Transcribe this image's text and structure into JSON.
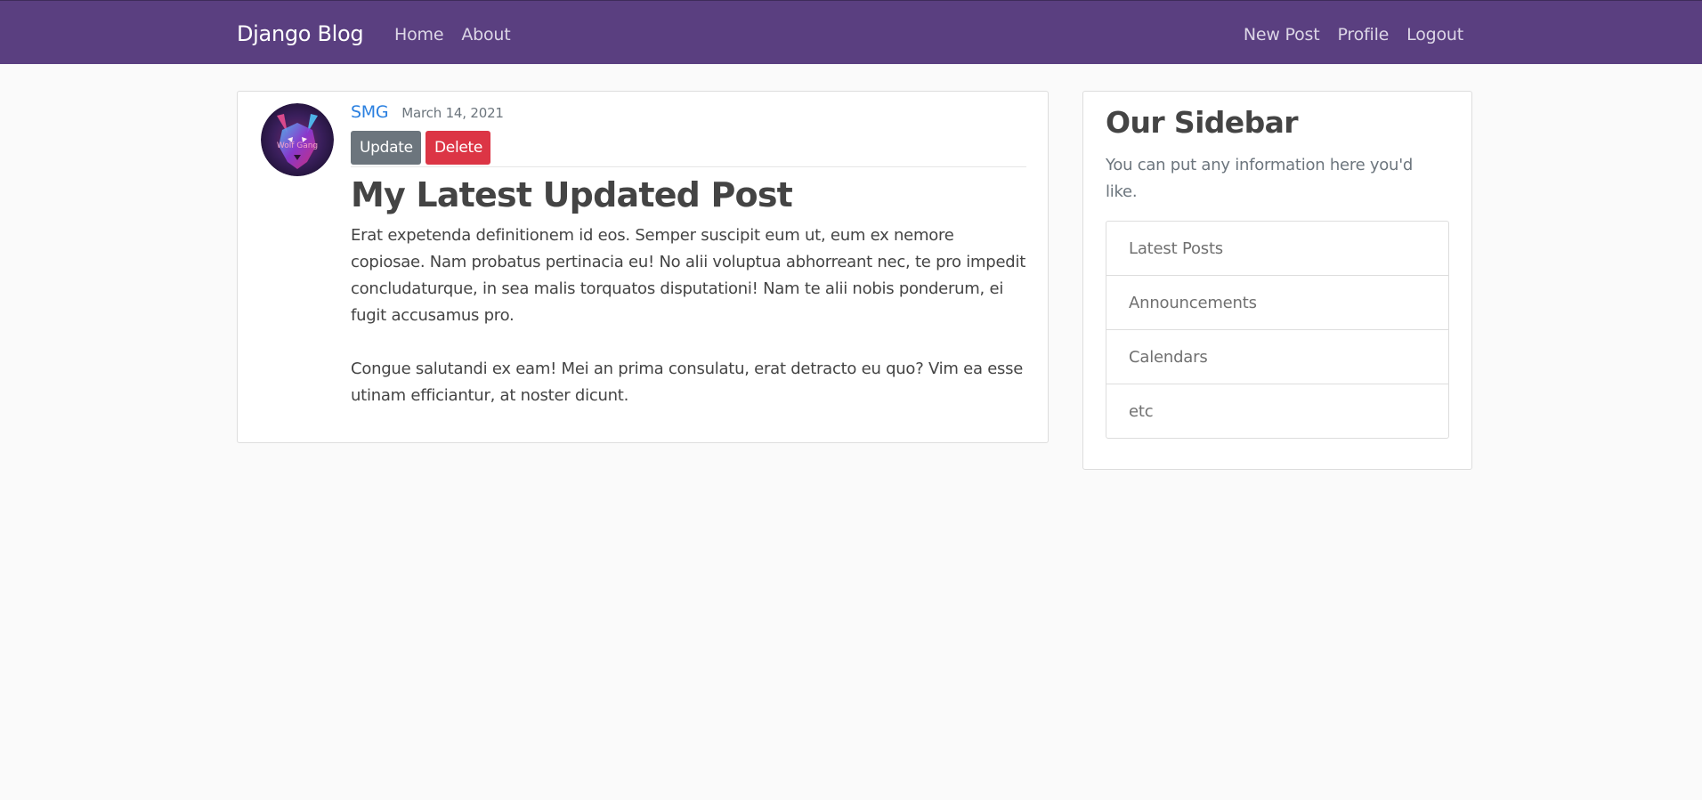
{
  "navbar": {
    "brand": "Django Blog",
    "left_links": [
      "Home",
      "About"
    ],
    "right_links": [
      "New Post",
      "Profile",
      "Logout"
    ],
    "background": "#5a3f80"
  },
  "post": {
    "avatar_icon": "wolf-avatar-image",
    "avatar_text": "Wolf Gang",
    "author": "SMG",
    "date": "March 14, 2021",
    "update_label": "Update",
    "delete_label": "Delete",
    "title": "My Latest Updated Post",
    "content": "Erat expetenda definitionem id eos. Semper suscipit eum ut, eum ex nemore copiosae. Nam probatus pertinacia eu! No alii voluptua abhorreant nec, te pro impedit concludaturque, in sea malis torquatos disputationi! Nam te alii nobis ponderum, ei fugit accusamus pro.\n\nCongue salutandi ex eam! Mei an prima consulatu, erat detracto eu quo? Vim ea esse utinam efficiantur, at noster dicunt."
  },
  "sidebar": {
    "title": "Our Sidebar",
    "text": "You can put any information here you'd like.",
    "items": [
      "Latest Posts",
      "Announcements",
      "Calendars",
      "etc"
    ]
  },
  "colors": {
    "link": "#2b80e0",
    "secondary": "#6c757d",
    "danger": "#dc3545",
    "page_background": "#fafafa"
  }
}
